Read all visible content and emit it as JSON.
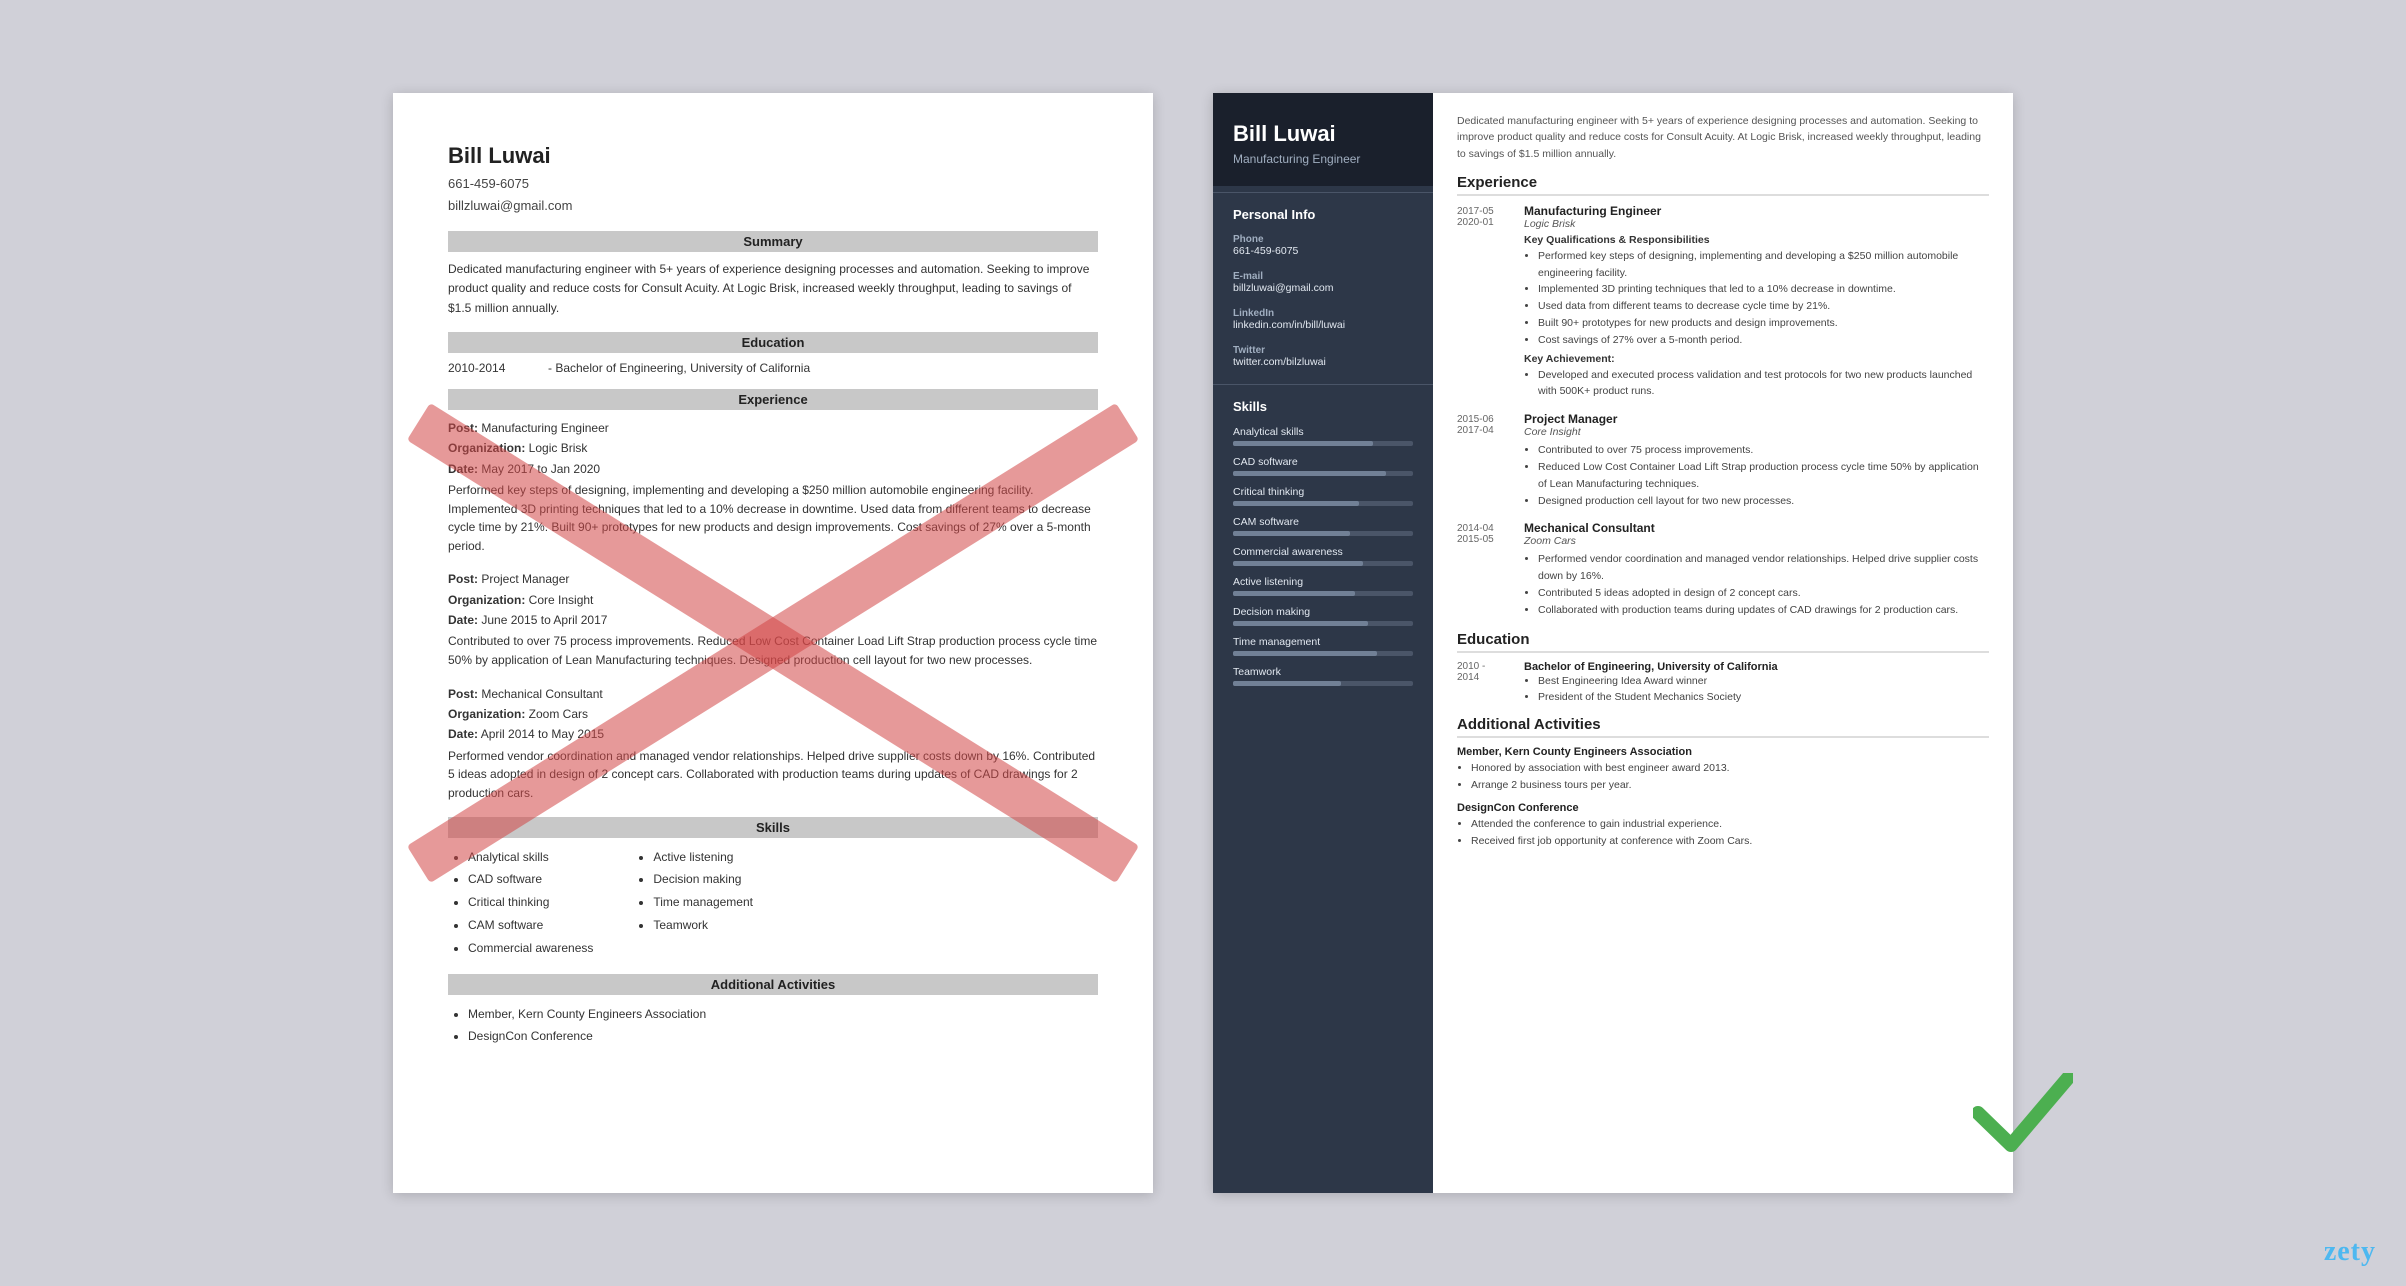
{
  "left": {
    "name": "Bill Luwai",
    "phone": "661-459-6075",
    "email": "billzluwai@gmail.com",
    "sections": {
      "summary": {
        "label": "Summary",
        "text": "Dedicated manufacturing engineer with 5+ years of experience designing processes and automation. Seeking to improve product quality and reduce costs for Consult Acuity. At Logic Brisk, increased weekly throughput, leading to savings of $1.5 million annually."
      },
      "education": {
        "label": "Education",
        "entries": [
          {
            "years": "2010-2014",
            "degree": "Bachelor of Engineering, University of California"
          }
        ]
      },
      "experience": {
        "label": "Experience",
        "entries": [
          {
            "post_label": "Post:",
            "post": "Manufacturing Engineer",
            "org_label": "Organization:",
            "org": "Logic Brisk",
            "date_label": "Date:",
            "date": "May 2017 to Jan 2020",
            "desc": "Performed key steps of designing, implementing and developing a $250 million automobile engineering facility. Implemented 3D printing techniques that led to a 10% decrease in downtime. Used data from different teams to decrease cycle time by 21%. Built 90+ prototypes for new products and design improvements. Cost savings of 27% over a 5-month period."
          },
          {
            "post_label": "Post:",
            "post": "Project Manager",
            "org_label": "Organization:",
            "org": "Core Insight",
            "date_label": "Date:",
            "date": "June 2015 to April 2017",
            "desc": "Contributed to over 75 process improvements. Reduced Low Cost Container Load Lift Strap production process cycle time 50% by application of Lean Manufacturing techniques. Designed production cell layout for two new processes."
          },
          {
            "post_label": "Post:",
            "post": "Mechanical Consultant",
            "org_label": "Organization:",
            "org": "Zoom Cars",
            "date_label": "Date:",
            "date": "April 2014 to May 2015",
            "desc": "Performed vendor coordination and managed vendor relationships. Helped drive supplier costs down by 16%. Contributed 5 ideas adopted in design of 2 concept cars. Collaborated with production teams during updates of CAD drawings for 2 production cars."
          }
        ]
      },
      "skills": {
        "label": "Skills",
        "col1": [
          "Analytical skills",
          "CAD software",
          "Critical thinking",
          "CAM software",
          "Commercial awareness"
        ],
        "col2": [
          "Active listening",
          "Decision making",
          "Time management",
          "Teamwork"
        ]
      },
      "activities": {
        "label": "Additional Activities",
        "entries": [
          "Member, Kern County Engineers Association",
          "DesignCon Conference"
        ]
      }
    }
  },
  "right": {
    "name": "Bill Luwai",
    "title": "Manufacturing Engineer",
    "summary": "Dedicated manufacturing engineer with 5+ years of experience designing processes and automation. Seeking to improve product quality and reduce costs for Consult Acuity. At Logic Brisk, increased weekly throughput, leading to savings of $1.5 million annually.",
    "sidebar": {
      "personal_info_label": "Personal Info",
      "phone_label": "Phone",
      "phone": "661-459-6075",
      "email_label": "E-mail",
      "email": "billzluwai@gmail.com",
      "linkedin_label": "LinkedIn",
      "linkedin": "linkedin.com/in/bill/luwai",
      "twitter_label": "Twitter",
      "twitter": "twitter.com/bilzluwai",
      "skills_label": "Skills",
      "skills": [
        {
          "name": "Analytical skills",
          "pct": 78
        },
        {
          "name": "CAD software",
          "pct": 85
        },
        {
          "name": "Critical thinking",
          "pct": 70
        },
        {
          "name": "CAM software",
          "pct": 65
        },
        {
          "name": "Commercial awareness",
          "pct": 72
        },
        {
          "name": "Active listening",
          "pct": 68
        },
        {
          "name": "Decision making",
          "pct": 75
        },
        {
          "name": "Time management",
          "pct": 80
        },
        {
          "name": "Teamwork",
          "pct": 60
        }
      ]
    },
    "experience": {
      "label": "Experience",
      "entries": [
        {
          "dates": "2017-05\n2020-01",
          "title": "Manufacturing Engineer",
          "company": "Logic Brisk",
          "qual_label": "Key Qualifications & Responsibilities",
          "bullets": [
            "Performed key steps of designing, implementing and developing a $250 million automobile engineering facility.",
            "Implemented 3D printing techniques that led to a 10% decrease in downtime.",
            "Used data from different teams to decrease cycle time by 21%.",
            "Built 90+ prototypes for new products and design improvements.",
            "Cost savings of 27% over a 5-month period."
          ],
          "achievement_label": "Key Achievement:",
          "achievement": "Developed and executed process validation and test protocols for two new products launched with 500K+ product runs."
        },
        {
          "dates": "2015-06\n2017-04",
          "title": "Project Manager",
          "company": "Core Insight",
          "bullets": [
            "Contributed to over 75 process improvements.",
            "Reduced Low Cost Container Load Lift Strap production process cycle time 50% by application of Lean Manufacturing techniques.",
            "Designed production cell layout for two new processes."
          ]
        },
        {
          "dates": "2014-04\n2015-05",
          "title": "Mechanical Consultant",
          "company": "Zoom Cars",
          "bullets": [
            "Performed vendor coordination and managed vendor relationships. Helped drive supplier costs down by 16%.",
            "Contributed 5 ideas adopted in design of 2 concept cars.",
            "Collaborated with production teams during updates of CAD drawings for 2 production cars."
          ]
        }
      ]
    },
    "education": {
      "label": "Education",
      "entries": [
        {
          "dates": "2010 -\n2014",
          "degree": "Bachelor of Engineering, University of California",
          "bullets": [
            "Best Engineering Idea Award winner",
            "President of the Student Mechanics Society"
          ]
        }
      ]
    },
    "activities": {
      "label": "Additional Activities",
      "entries": [
        {
          "title": "Member, Kern County Engineers Association",
          "bullets": [
            "Honored by association with best engineer award 2013.",
            "Arrange 2 business tours per year."
          ]
        },
        {
          "title": "DesignCon Conference",
          "bullets": [
            "Attended the conference to gain industrial experience.",
            "Received first job opportunity at conference with Zoom Cars."
          ]
        }
      ]
    }
  },
  "branding": {
    "zety": "zety"
  }
}
